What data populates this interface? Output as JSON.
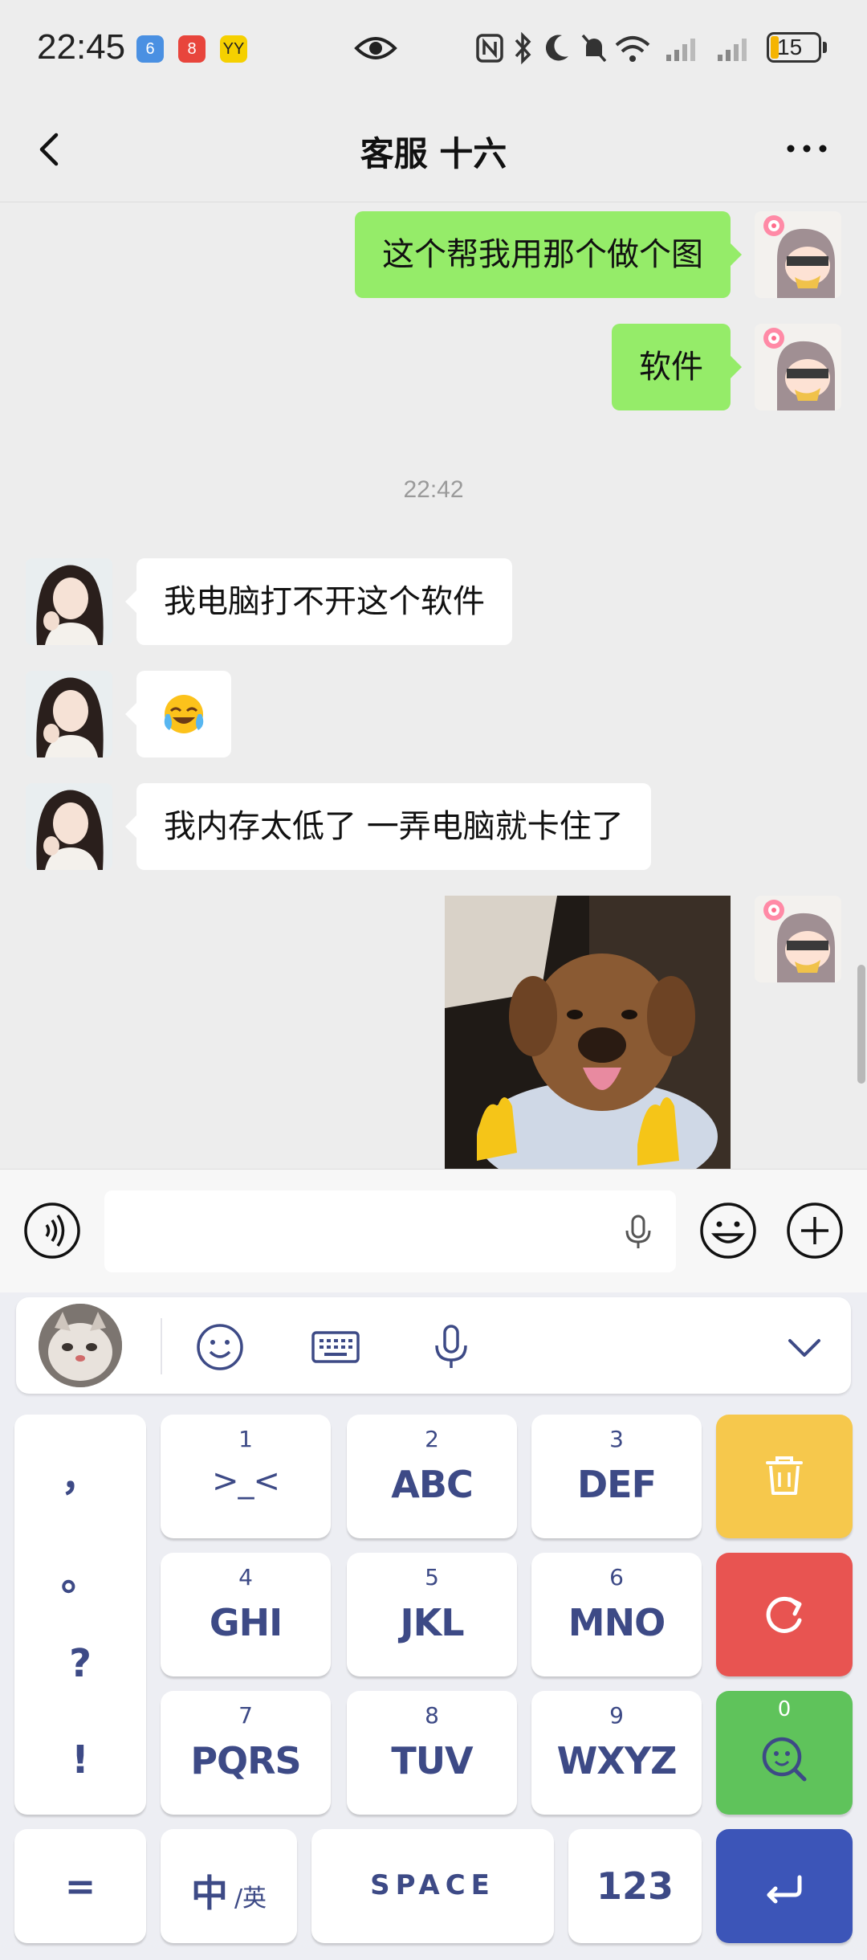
{
  "status_bar": {
    "time": "22:45",
    "apps": [
      {
        "name": "app-6",
        "label": "6",
        "color": "#4a90e2"
      },
      {
        "name": "app-8",
        "label": "8",
        "color": "#e8453c"
      },
      {
        "name": "app-yy",
        "label": "YY",
        "color": "#f5d000"
      }
    ],
    "battery": "15",
    "icons": [
      "eye-icon",
      "nfc-icon",
      "bluetooth-icon",
      "moon-icon",
      "mute-icon",
      "wifi-icon",
      "signal-icon",
      "signal-icon"
    ]
  },
  "header": {
    "title": "客服 十六"
  },
  "chat": {
    "messages": [
      {
        "side": "right",
        "text": "这个帮我用那个做个图"
      },
      {
        "side": "right",
        "text": "软件"
      },
      {
        "side": "left",
        "text": "我电脑打不开这个软件"
      },
      {
        "side": "left",
        "text": "😭"
      },
      {
        "side": "left",
        "text": "我内存太低了 一弄电脑就卡住了"
      },
      {
        "side": "right",
        "type": "image",
        "text": ""
      }
    ],
    "timestamp": "22:42"
  },
  "input_bar": {
    "value": ""
  },
  "keyboard": {
    "keys": [
      {
        "num": "1",
        "letters": ">_<"
      },
      {
        "num": "2",
        "letters": "ABC"
      },
      {
        "num": "3",
        "letters": "DEF"
      },
      {
        "num": "4",
        "letters": "GHI"
      },
      {
        "num": "5",
        "letters": "JKL"
      },
      {
        "num": "6",
        "letters": "MNO"
      },
      {
        "num": "7",
        "letters": "PQRS"
      },
      {
        "num": "8",
        "letters": "TUV"
      },
      {
        "num": "9",
        "letters": "WXYZ"
      }
    ],
    "punctuation": [
      "，",
      "。",
      "?",
      "!"
    ],
    "search_count": "0",
    "bottom": {
      "equals": "=",
      "lang_main": "中",
      "lang_alt": "/英",
      "space": "SPACE",
      "numbers": "123"
    },
    "colors": {
      "delete": "#f6c84c",
      "reset": "#e85451",
      "search": "#5fc35b",
      "enter": "#3c55b8",
      "key_text": "#3d4a86"
    }
  }
}
